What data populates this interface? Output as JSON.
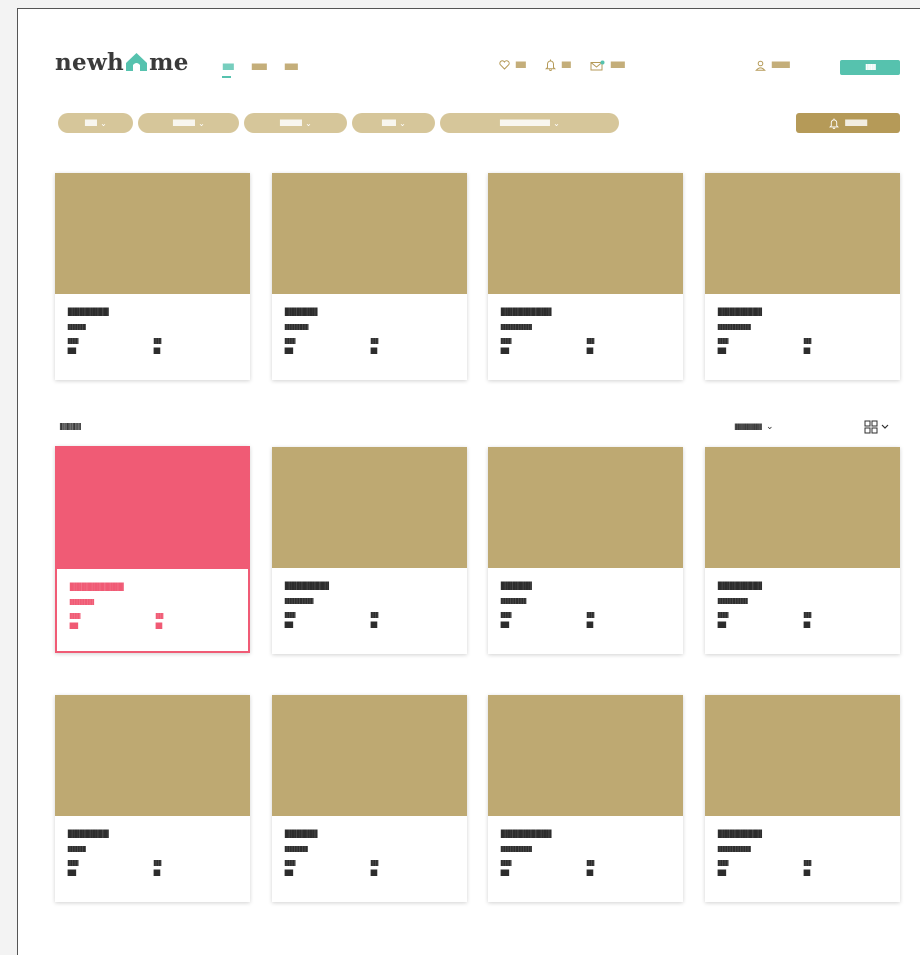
{
  "brand": {
    "logo_left": "newh",
    "logo_right": "me",
    "accent": "#56c2ae",
    "gold": "#b59a58",
    "card_image": "#bea972",
    "highlight": "#f05b75"
  },
  "nav": [
    {
      "label": "IIIIIIIIIII",
      "active": true
    },
    {
      "label": "IIIIIIIIIIIIIII",
      "active": false
    },
    {
      "label": "IIIIIIIIIIIII",
      "active": false
    }
  ],
  "utilities": {
    "favorites": {
      "icon": "heart-icon",
      "label": "IIIIIIIIII"
    },
    "alerts": {
      "icon": "bell-icon",
      "label": "IIIIIIIII"
    },
    "messages": {
      "icon": "mail-icon",
      "label": "IIIIIIIIIIIIII"
    }
  },
  "account": {
    "icon": "user-icon",
    "label": "IIIIIIIIIIIIIIIIII"
  },
  "register_button": "IIIIIIIIIIIIII",
  "filters": [
    {
      "label": "IIIIIIIIIIII"
    },
    {
      "label": "IIIIIIIIIIIIIIIIIIIIII"
    },
    {
      "label": "IIIIIIIIIIIIIIIIIIIIII"
    },
    {
      "label": "IIIIIIIIIIIIII"
    },
    {
      "label": "IIIIIIIIIIIIIIIIIIIIIIIIIIIIIIIIIIIIIIIIIIIIIIIIII"
    }
  ],
  "alert_button": "IIIIIIIIIIIIIIIIIIIIII",
  "featured": [
    {
      "title": "IIIIIIIIIIIIIIIIIIIIIIIII",
      "subtitle": "IIIIIIIIIIIIIIIIIIIIIIIIIIIII",
      "meta_1": "IIIIIIIIIIIIIIIII",
      "meta_1_value": "IIIIIIIII",
      "meta_2": "IIIIIIIIIIII",
      "meta_2_value": "IIIIIII"
    },
    {
      "title": "IIIIIIIIIIIIIIIIIIII",
      "subtitle": "IIIIIIIIIIIIIIIIIIIIIIIIIIIIIIIIIIIIII",
      "meta_1": "IIIIIIIIIIIIIIIII",
      "meta_1_value": "IIIIIIIII",
      "meta_2": "IIIIIIIIIIII",
      "meta_2_value": "IIIIIII"
    },
    {
      "title": "IIIIIIIIIIIIIIIIIIIIIIIIIIIIIII",
      "subtitle": "IIIIIIIIIIIIIIIIIIIIIIIIIIIIIIIIIIIIIIIIIIIIIIIIII",
      "meta_1": "IIIIIIIIIIIIIIIII",
      "meta_1_value": "IIIIIIIII",
      "meta_2": "IIIIIIIIIIII",
      "meta_2_value": "IIIIIII"
    },
    {
      "title": "IIIIIIIIIIIIIIIIIIIIIIIIIII",
      "subtitle": "IIIIIIIIIIIIIIIIIIIIIIIIIIIIIIIIIIIIIIIIIIIIIIIIIIIII",
      "meta_1": "IIIIIIIIIIIIIIIII",
      "meta_1_value": "IIIIIIIII",
      "meta_2": "IIIIIIIIIIII",
      "meta_2_value": "IIIIIII"
    }
  ],
  "results_count": "IIIIIIIIIIIIIIIIII",
  "sort_label": "IIIIIIIIIIIIIIIIIIIIIIIIIIIIII",
  "view_toggle": {
    "icon": "grid-view-icon"
  },
  "listings": [
    {
      "title": "IIIIIIIIIIIIIIIIIIIIIIIIIIIIIIIII",
      "subtitle": "IIIIIIIIIIIIIIIIIIIIIIIIIIIIIIIIIIIIIII",
      "meta_1": "IIIIIIIIIIIIIIIII",
      "meta_1_value": "IIIIIIIII",
      "meta_2": "IIIIIIIIIIII",
      "meta_2_value": "IIIIIII",
      "highlighted": true
    },
    {
      "title": "IIIIIIIIIIIIIIIIIIIIIIIIIII",
      "subtitle": "IIIIIIIIIIIIIIIIIIIIIIIIIIIIIIIIIIIIIIIIIIIIII",
      "meta_1": "IIIIIIIIIIIIIIIII",
      "meta_1_value": "IIIIIIIII",
      "meta_2": "IIIIIIIIIIII",
      "meta_2_value": "IIIIIII"
    },
    {
      "title": "IIIIIIIIIIIIIIIIIII",
      "subtitle": "IIIIIIIIIIIIIIIIIIIIIIIIIIIIIIIIIIIIIIIII",
      "meta_1": "IIIIIIIIIIIIIIIII",
      "meta_1_value": "IIIIIIIII",
      "meta_2": "IIIIIIIIIIII",
      "meta_2_value": "IIIIIII"
    },
    {
      "title": "IIIIIIIIIIIIIIIIIIIIIIIIIII",
      "subtitle": "IIIIIIIIIIIIIIIIIIIIIIIIIIIIIIIIIIIIIIIIIIIIIIII",
      "meta_1": "IIIIIIIIIIIIIIIII",
      "meta_1_value": "IIIIIIIII",
      "meta_2": "IIIIIIIIIIII",
      "meta_2_value": "IIIIIII"
    },
    {
      "title": "IIIIIIIIIIIIIIIIIIIIIIIII",
      "subtitle": "IIIIIIIIIIIIIIIIIIIIIIIIIIIII",
      "meta_1": "IIIIIIIIIIIIIIIII",
      "meta_1_value": "IIIIIIIII",
      "meta_2": "IIIIIIIIIIII",
      "meta_2_value": "IIIIIII"
    },
    {
      "title": "IIIIIIIIIIIIIIIIIIII",
      "subtitle": "IIIIIIIIIIIIIIIIIIIIIIIIIIIIIIIIIIIII",
      "meta_1": "IIIIIIIIIIIIIIIII",
      "meta_1_value": "IIIIIIIII",
      "meta_2": "IIIIIIIIIIII",
      "meta_2_value": "IIIIIII"
    },
    {
      "title": "IIIIIIIIIIIIIIIIIIIIIIIIIIIIIII",
      "subtitle": "IIIIIIIIIIIIIIIIIIIIIIIIIIIIIIIIIIIIIIIIIIIIIIIIII",
      "meta_1": "IIIIIIIIIIIIIIIII",
      "meta_1_value": "IIIIIIIII",
      "meta_2": "IIIIIIIIIIII",
      "meta_2_value": "IIIIIII"
    },
    {
      "title": "IIIIIIIIIIIIIIIIIIIIIIIIIII",
      "subtitle": "IIIIIIIIIIIIIIIIIIIIIIIIIIIIIIIIIIIIIIIIIIIIIIIIIIIII",
      "meta_1": "IIIIIIIIIIIIIIIII",
      "meta_1_value": "IIIIIIIII",
      "meta_2": "IIIIIIIIIIII",
      "meta_2_value": "IIIIIII"
    }
  ]
}
